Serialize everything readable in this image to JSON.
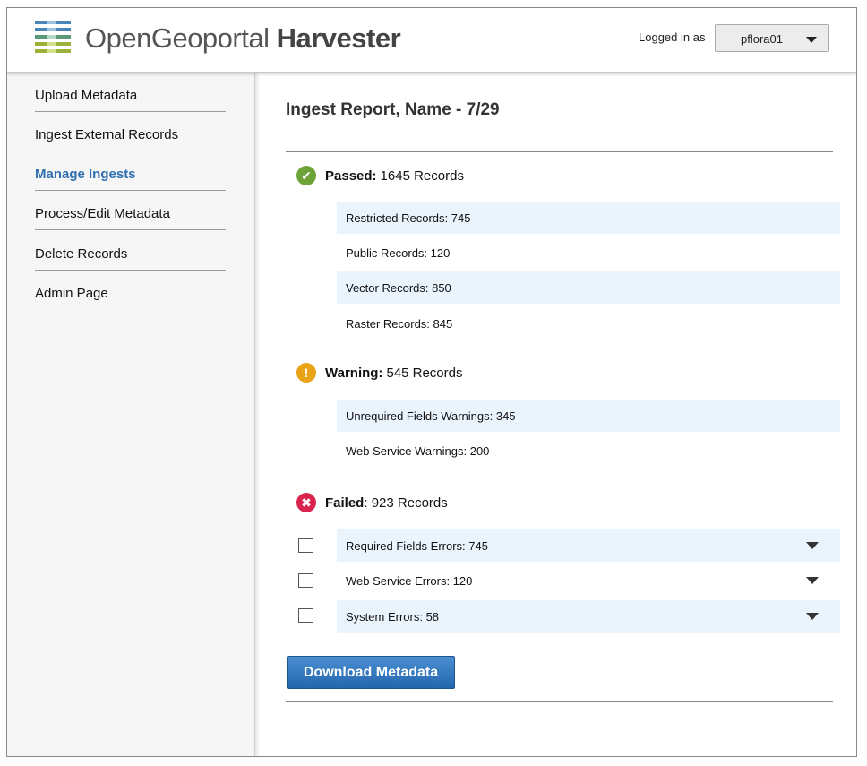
{
  "header": {
    "brand_light": "OpenGeoportal",
    "brand_bold": "Harvester",
    "logged_in_label": "Logged in as",
    "username": "pflora01"
  },
  "sidebar": {
    "items": [
      {
        "label": "Upload Metadata"
      },
      {
        "label": "Ingest External Records"
      },
      {
        "label": "Manage Ingests"
      },
      {
        "label": "Process/Edit Metadata"
      },
      {
        "label": "Delete Records"
      },
      {
        "label": "Admin Page"
      }
    ],
    "active_index": 2
  },
  "report": {
    "title": "Ingest Report, Name - 7/29",
    "passed": {
      "label": "Passed:",
      "count": "1645 Records",
      "icon": "check-icon",
      "color": "#6ea33a",
      "rows": [
        "Restricted Records: 745",
        "Public Records: 120",
        "Vector Records: 850",
        "Raster Records: 845"
      ]
    },
    "warning": {
      "label": "Warning:",
      "count": "545 Records",
      "icon": "exclamation-icon",
      "color": "#e8a317",
      "rows": [
        "Unrequired Fields Warnings: 345",
        "Web Service Warnings: 200"
      ]
    },
    "failed": {
      "label": "Failed",
      "count": ": 923 Records",
      "icon": "x-icon",
      "color": "#d9254e",
      "rows": [
        "Required Fields Errors: 745",
        "Web Service Errors: 120",
        "System Errors: 58"
      ]
    },
    "download_label": "Download Metadata"
  },
  "colors": {
    "accent": "#2f6fb0",
    "row_shade": "#eaf4fd",
    "button": "#2f75bd"
  }
}
